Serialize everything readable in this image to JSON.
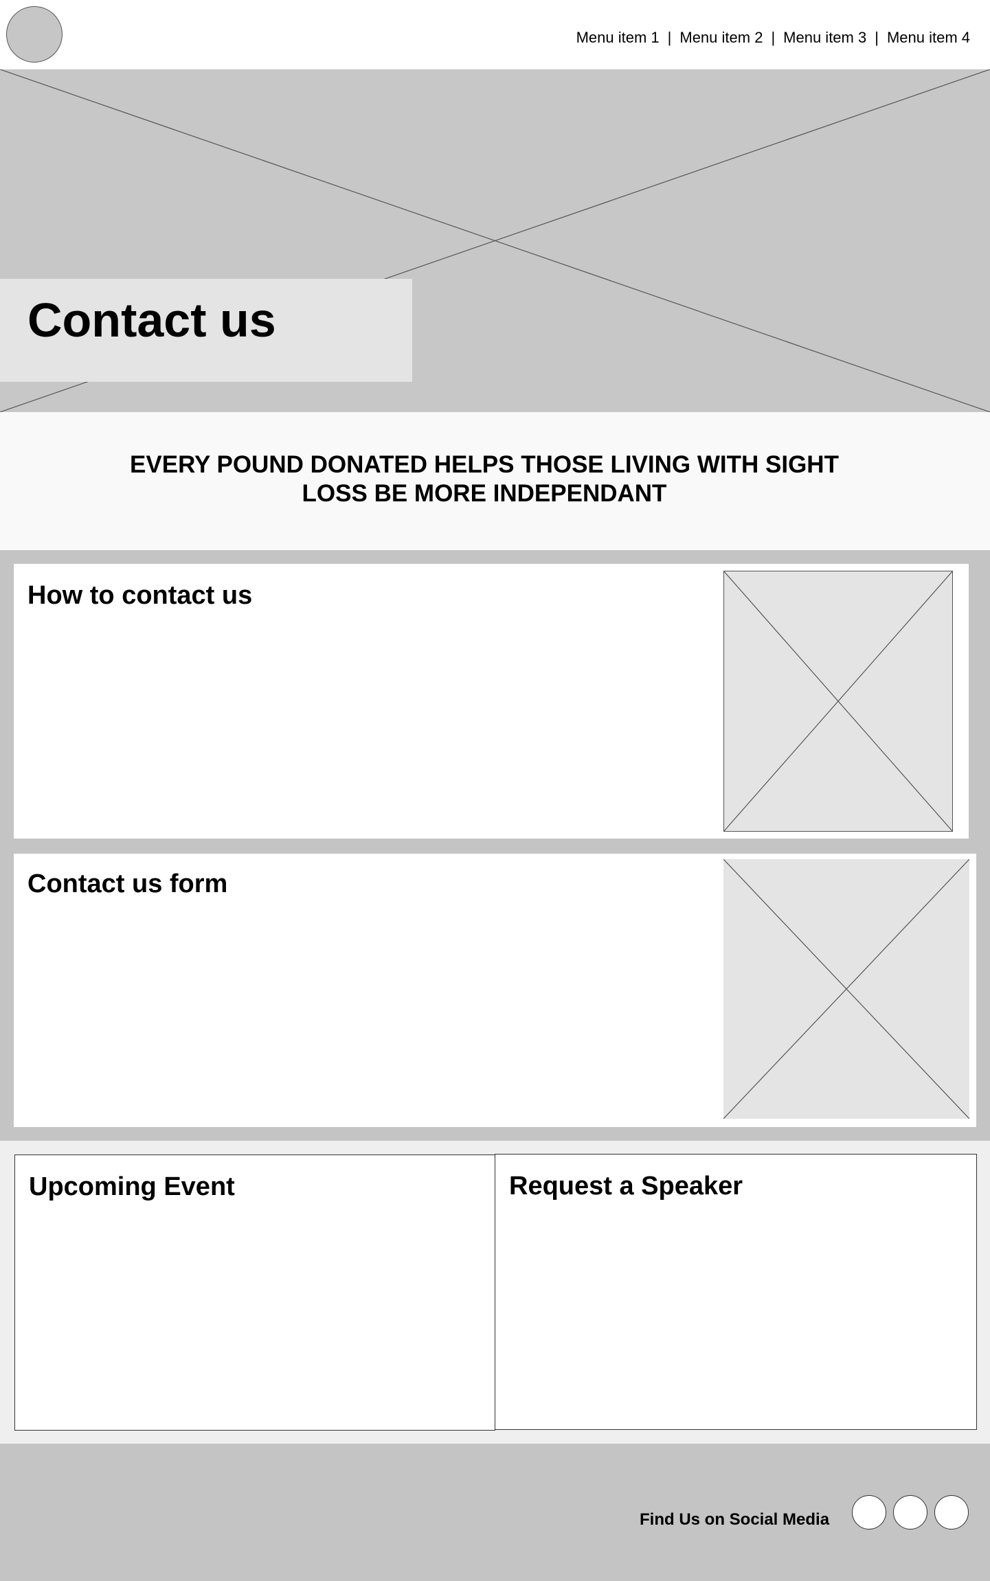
{
  "header": {
    "logo_icon": "logo-circle",
    "menu": [
      "Menu item 1",
      "Menu item 2",
      "Menu item 3",
      "Menu item 4"
    ],
    "separator": "|"
  },
  "hero": {
    "title": "Contact us",
    "image_icon": "image-placeholder"
  },
  "banner": {
    "text": "EVERY POUND DONATED HELPS THOSE LIVING WITH SIGHT LOSS BE MORE INDEPENDANT"
  },
  "sections": {
    "how_to_contact": {
      "title": "How to contact us",
      "image_icon": "image-placeholder"
    },
    "contact_form": {
      "title": "Contact us form",
      "image_icon": "image-placeholder"
    }
  },
  "panels": {
    "upcoming_event": {
      "title": "Upcoming Event"
    },
    "request_speaker": {
      "title": "Request a Speaker"
    }
  },
  "footer": {
    "social_label": "Find Us on Social Media",
    "social_icons": [
      "social-icon",
      "social-icon",
      "social-icon"
    ]
  },
  "colors": {
    "hero_bg": "#c7c7c7",
    "placeholder_bg": "#e4e4e4",
    "section_bg": "#c4c4c4",
    "banner_bg": "#f9f9f9",
    "lower_bg": "#efefef"
  }
}
